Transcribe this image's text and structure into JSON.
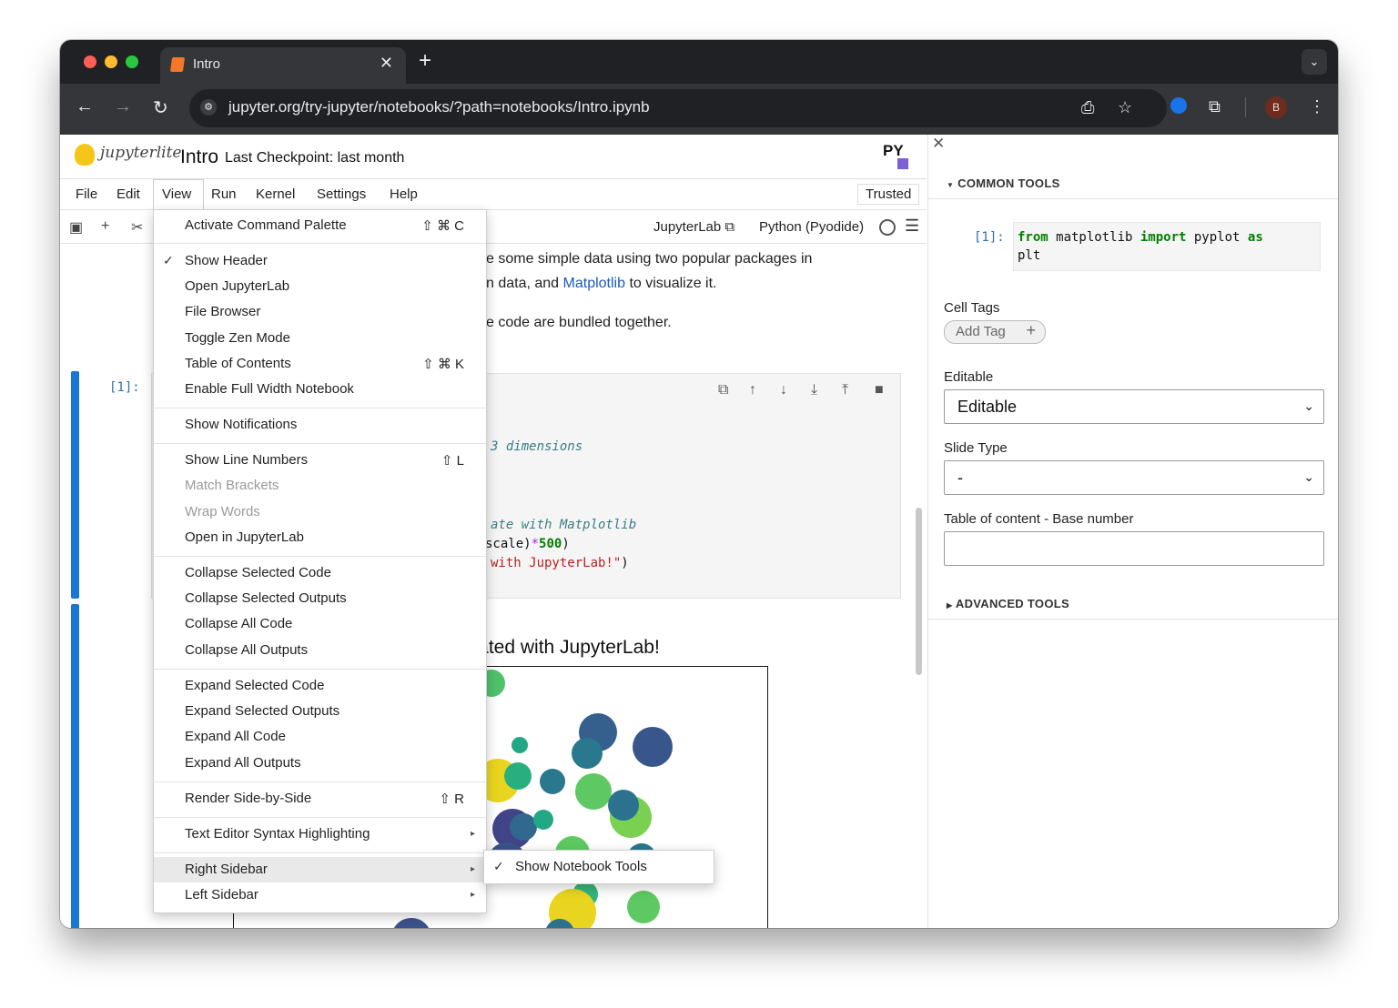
{
  "browser": {
    "tab_title": "Intro",
    "url": "jupyter.org/try-jupyter/notebooks/?path=notebooks/Intro.ipynb",
    "avatar_initial": "B"
  },
  "header": {
    "logo_text": "jupyterlite",
    "title": "Intro",
    "checkpoint": "Last Checkpoint: last month",
    "kernel_logo_text": "PY"
  },
  "menubar": {
    "items": [
      "File",
      "Edit",
      "View",
      "Run",
      "Kernel",
      "Settings",
      "Help"
    ],
    "trusted": "Trusted"
  },
  "nb_toolbar": {
    "open_in": "JupyterLab",
    "kernel": "Python (Pyodide)"
  },
  "notebook": {
    "md_line1": "e some simple data using two popular packages in",
    "md_line2_pre": "n data, and ",
    "md_line2_link": "Matplotlib",
    "md_line2_post": " to visualize it.",
    "md_line3": "e code are bundled together.",
    "cell_prompt": "[1]:",
    "code_line1": "3 dimensions",
    "code_line2": "ate with Matplotlib",
    "code_line3_a": "scale)",
    "code_line3_b": "*",
    "code_line3_c": "500",
    "code_line3_d": ")",
    "code_line4_a": "with JupyterLab!\"",
    "code_line4_b": ")",
    "plot_title": "created with JupyterLab!"
  },
  "sidebar": {
    "common_tools": "COMMON TOOLS",
    "prompt": "[1]:",
    "code_from": "from",
    "code_mod": " matplotlib ",
    "code_import": "import",
    "code_name": " pyplot ",
    "code_as": "as",
    "code_alias": "plt",
    "cell_tags_label": "Cell Tags",
    "add_tag": "Add Tag",
    "editable_label": "Editable",
    "editable_value": "Editable",
    "slide_type_label": "Slide Type",
    "slide_type_value": "-",
    "toc_label": "Table of content - Base number",
    "toc_value": "",
    "advanced_tools": "ADVANCED TOOLS"
  },
  "view_menu": {
    "items": [
      {
        "label": "Activate Command Palette",
        "shortcut": "⇧ ⌘ C"
      },
      {
        "label": "Show Header",
        "checked": true
      },
      {
        "label": "Open JupyterLab"
      },
      {
        "label": "File Browser"
      },
      {
        "label": "Toggle Zen Mode"
      },
      {
        "label": "Table of Contents",
        "shortcut": "⇧ ⌘ K"
      },
      {
        "label": "Enable Full Width Notebook"
      },
      {
        "label": "Show Notifications"
      },
      {
        "label": "Show Line Numbers",
        "shortcut": "⇧ L"
      },
      {
        "label": "Match Brackets",
        "disabled": true
      },
      {
        "label": "Wrap Words",
        "disabled": true
      },
      {
        "label": "Open in JupyterLab"
      },
      {
        "label": "Collapse Selected Code"
      },
      {
        "label": "Collapse Selected Outputs"
      },
      {
        "label": "Collapse All Code"
      },
      {
        "label": "Collapse All Outputs"
      },
      {
        "label": "Expand Selected Code"
      },
      {
        "label": "Expand Selected Outputs"
      },
      {
        "label": "Expand All Code"
      },
      {
        "label": "Expand All Outputs"
      },
      {
        "label": "Render Side-by-Side",
        "shortcut": "⇧ R"
      },
      {
        "label": "Text Editor Syntax Highlighting",
        "submenu": true
      },
      {
        "label": "Right Sidebar",
        "submenu": true,
        "highlighted": true
      },
      {
        "label": "Left Sidebar",
        "submenu": true
      }
    ],
    "submenu_item": "Show Notebook Tools"
  }
}
